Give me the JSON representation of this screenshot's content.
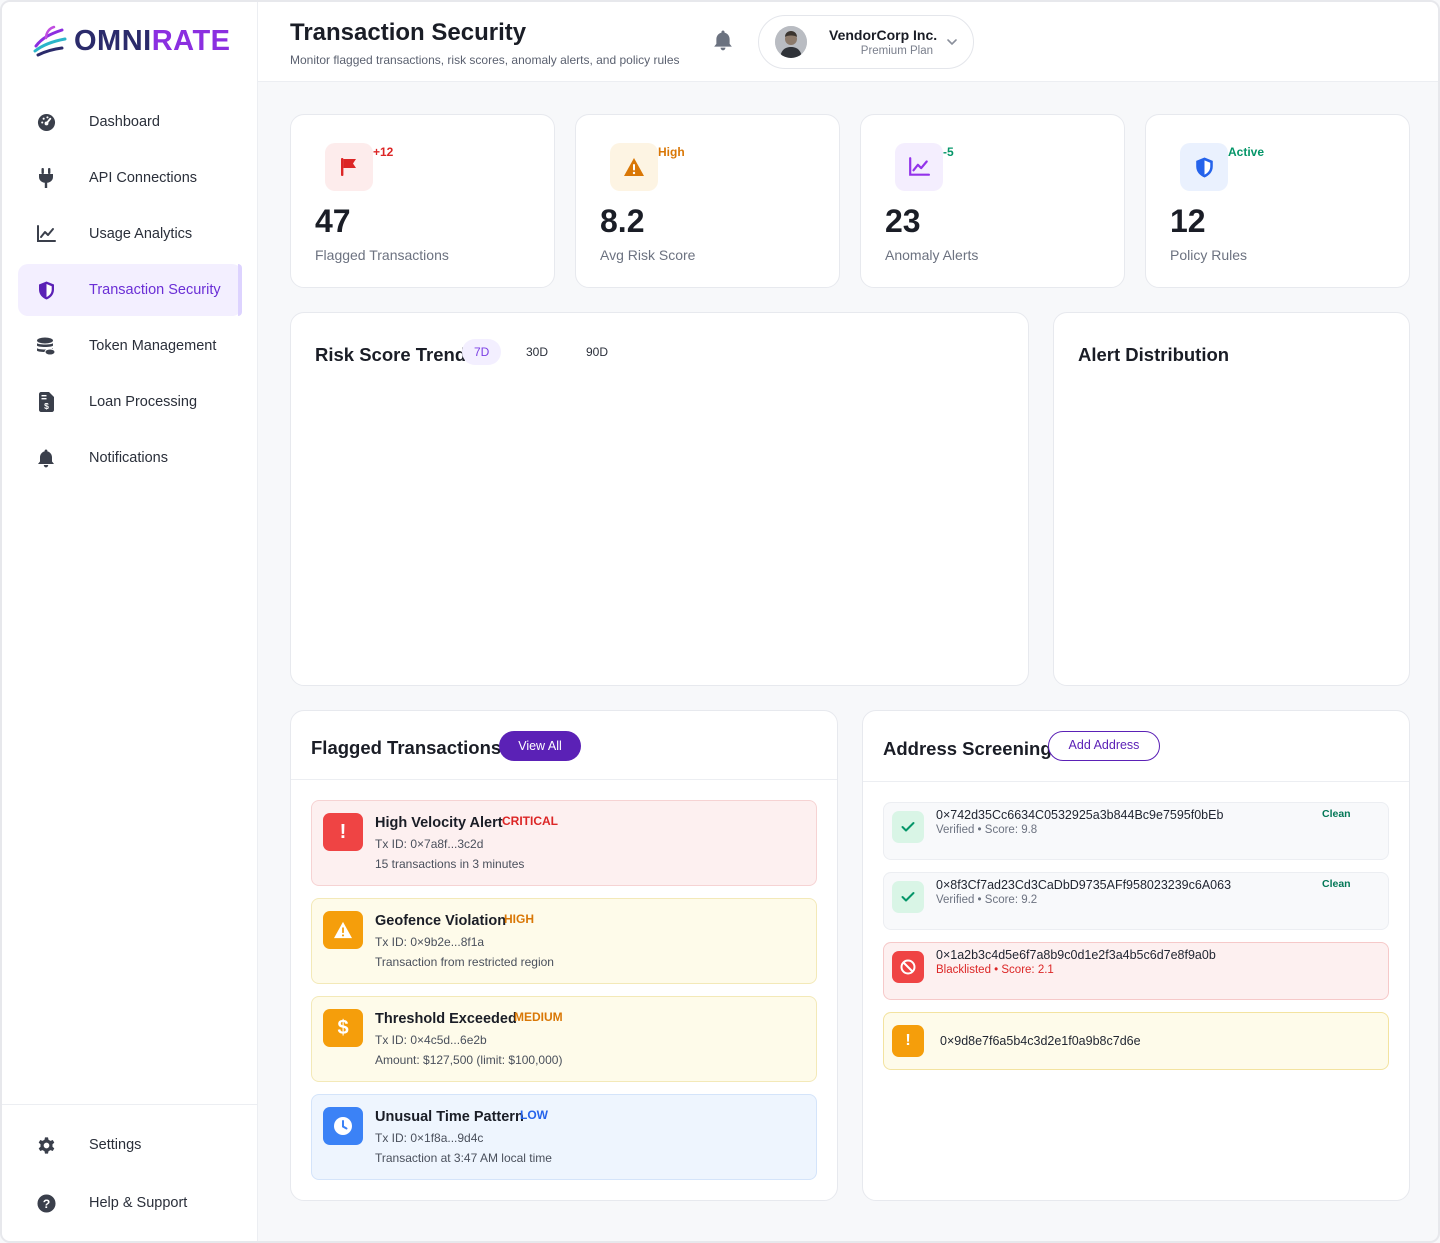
{
  "brand": {
    "name_a": "OMNI",
    "name_b": "RATE"
  },
  "sidebar": {
    "items": [
      {
        "label": "Dashboard",
        "icon": "dashboard-icon"
      },
      {
        "label": "API Connections",
        "icon": "plug-icon"
      },
      {
        "label": "Usage Analytics",
        "icon": "chart-line-icon"
      },
      {
        "label": "Transaction Security",
        "icon": "shield-icon",
        "active": true
      },
      {
        "label": "Token Management",
        "icon": "coins-icon"
      },
      {
        "label": "Loan Processing",
        "icon": "invoice-dollar-icon"
      },
      {
        "label": "Notifications",
        "icon": "bell-icon"
      }
    ],
    "bottom": [
      {
        "label": "Settings",
        "icon": "gear-icon"
      },
      {
        "label": "Help & Support",
        "icon": "question-circle-icon"
      }
    ]
  },
  "header": {
    "title": "Transaction Security",
    "subtitle": "Monitor flagged transactions, risk scores, anomaly alerts, and policy rules",
    "account_name": "VendorCorp Inc.",
    "account_plan": "Premium Plan"
  },
  "stats": [
    {
      "value": "47",
      "label": "Flagged Transactions",
      "badge": "+12",
      "badge_color": "#dc2626",
      "icon": "flag-icon",
      "icon_bg": "#fdecec",
      "icon_color": "#dc2626"
    },
    {
      "value": "8.2",
      "label": "Avg Risk Score",
      "badge": "High",
      "badge_color": "#d97706",
      "icon": "warning-icon",
      "icon_bg": "#fdf4e3",
      "icon_color": "#d97706"
    },
    {
      "value": "23",
      "label": "Anomaly Alerts",
      "badge": "-5",
      "badge_color": "#059669",
      "icon": "chart-line-icon",
      "icon_bg": "#f4eefe",
      "icon_color": "#9333ea"
    },
    {
      "value": "12",
      "label": "Policy Rules",
      "badge": "Active",
      "badge_color": "#059669",
      "icon": "shield-icon",
      "icon_bg": "#eaf1fe",
      "icon_color": "#2563eb"
    }
  ],
  "risk_trend": {
    "title": "Risk Score Trend",
    "ranges": [
      "7D",
      "30D",
      "90D"
    ],
    "selected": "7D"
  },
  "alert_distribution": {
    "title": "Alert Distribution"
  },
  "flagged": {
    "title": "Flagged Transactions",
    "view_all": "View All",
    "items": [
      {
        "title": "High Velocity Alert",
        "severity": "CRITICAL",
        "tx": "Tx ID: 0×7a8f...3c2d",
        "desc": "15 transactions in 3 minutes",
        "icon": "exclamation-icon",
        "glyph": "!",
        "bg": "#fdf0f0",
        "border": "#f6d3d3",
        "icon_bg": "#ef4444",
        "sev_color": "#dc2626"
      },
      {
        "title": "Geofence Violation",
        "severity": "HIGH",
        "tx": "Tx ID: 0×9b2e...8f1a",
        "desc": "Transaction from restricted region",
        "icon": "warning-icon",
        "glyph": "",
        "bg": "#fefbea",
        "border": "#f3e9b8",
        "icon_bg": "#f59e0b",
        "sev_color": "#d97706"
      },
      {
        "title": "Threshold Exceeded",
        "severity": "MEDIUM",
        "tx": "Tx ID: 0×4c5d...6e2b",
        "desc": "Amount: $127,500 (limit: $100,000)",
        "icon": "dollar-icon",
        "glyph": "$",
        "bg": "#fefbea",
        "border": "#f3e9b8",
        "icon_bg": "#f59e0b",
        "sev_color": "#d97706"
      },
      {
        "title": "Unusual Time Pattern",
        "severity": "LOW",
        "tx": "Tx ID: 0×1f8a...9d4c",
        "desc": "Transaction at 3:47 AM local time",
        "icon": "clock-icon",
        "glyph": "",
        "bg": "#eef5fe",
        "border": "#d4e4fa",
        "icon_bg": "#3b82f6",
        "sev_color": "#2563eb"
      }
    ]
  },
  "screening": {
    "title": "Address Screening",
    "add_label": "Add Address",
    "items": [
      {
        "hash": "0×742d35Cc6634C0532925a3b844Bc9e7595f0bEb",
        "status": "Verified • Score: 9.8",
        "tag": "Clean",
        "icon": "check-icon",
        "bg": "#f8f9fb",
        "border": "#eceef2",
        "icon_bg": "#d9f5e6",
        "icon_color": "#059669",
        "tag_color": "#047857",
        "status_color": "#6c7280"
      },
      {
        "hash": "0×8f3Cf7ad23Cd3CaDbD9735AFf958023239c6A063",
        "status": "Verified • Score: 9.2",
        "tag": "Clean",
        "icon": "check-icon",
        "bg": "#f8f9fb",
        "border": "#eceef2",
        "icon_bg": "#d9f5e6",
        "icon_color": "#059669",
        "tag_color": "#047857",
        "status_color": "#6c7280"
      },
      {
        "hash": "0×1a2b3c4d5e6f7a8b9c0d1e2f3a4b5c6d7e8f9a0b",
        "status": "Blacklisted • Score: 2.1",
        "tag": "",
        "icon": "ban-icon",
        "bg": "#fdf0f0",
        "border": "#f6c9c9",
        "icon_bg": "#ef4444",
        "icon_color": "#ffffff",
        "tag_color": "#f6c9c9",
        "status_color": "#dc2626"
      },
      {
        "hash": "0×9d8e7f6a5b4c3d2e1f0a9b8c7d6e",
        "status": "",
        "tag": "",
        "icon": "exclamation-icon",
        "bg": "#fefbea",
        "border": "#f3e3a0",
        "icon_bg": "#f59e0b",
        "icon_color": "#ffffff",
        "tag_color": "#d97706",
        "status_color": "#6c7280"
      }
    ]
  }
}
